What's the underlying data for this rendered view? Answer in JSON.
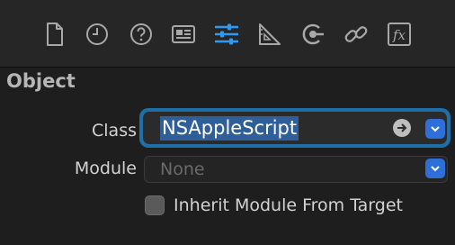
{
  "toolbar": {
    "icons": [
      {
        "name": "file-inspector-icon",
        "selected": false
      },
      {
        "name": "history-inspector-icon",
        "selected": false
      },
      {
        "name": "quick-help-icon",
        "selected": false
      },
      {
        "name": "identity-inspector-icon",
        "selected": false
      },
      {
        "name": "attributes-inspector-icon",
        "selected": true
      },
      {
        "name": "size-inspector-icon",
        "selected": false
      },
      {
        "name": "connections-inspector-icon",
        "selected": false
      },
      {
        "name": "bindings-inspector-icon",
        "selected": false
      },
      {
        "name": "effects-inspector-icon",
        "selected": false
      }
    ],
    "selected_color": "#2b9af3",
    "icon_color": "#a8a8a8"
  },
  "section": {
    "title": "Object"
  },
  "class_row": {
    "label": "Class",
    "value": "NSAppleScript"
  },
  "module_row": {
    "label": "Module",
    "placeholder": "None"
  },
  "inherit_checkbox": {
    "label": "Inherit Module From Target",
    "checked": false
  }
}
